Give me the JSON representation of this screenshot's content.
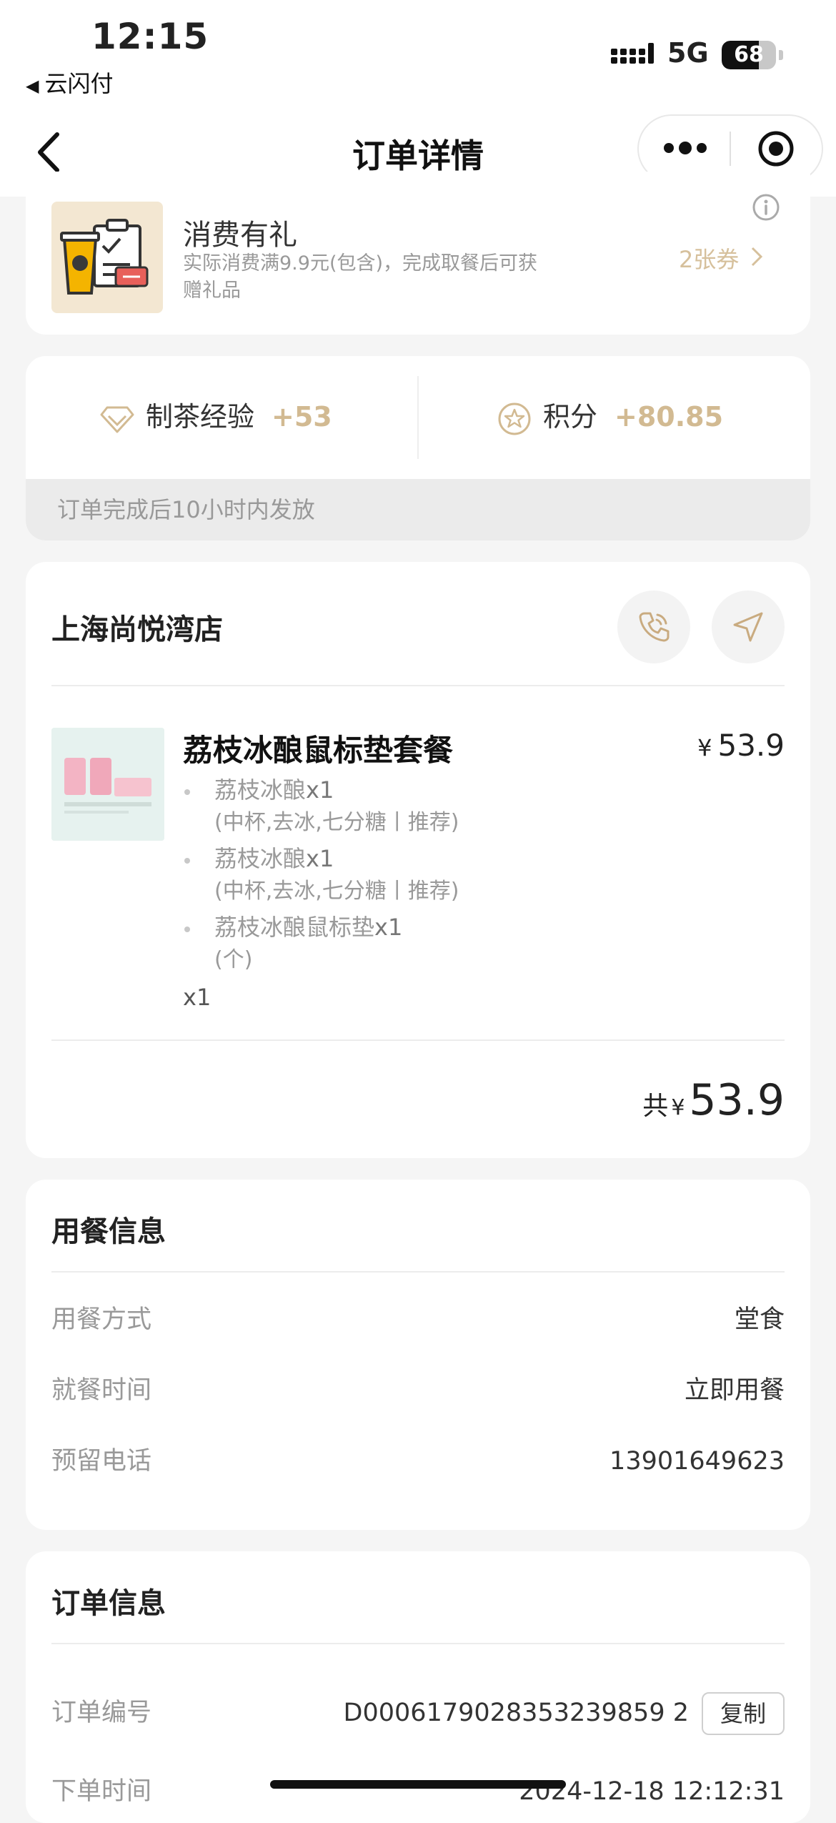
{
  "status_bar": {
    "time": "12:15",
    "back_app": "云闪付",
    "network": "5G",
    "battery": "68",
    "battery_level_pct": 68
  },
  "nav": {
    "title": "订单详情"
  },
  "gift": {
    "title": "消费有礼",
    "desc": "实际消费满9.9元(包含)，完成取餐后可获赠礼品",
    "coupon": "2张券"
  },
  "rewards": {
    "exp_label": "制茶经验",
    "exp_value": "+53",
    "points_label": "积分",
    "points_value": "+80.85",
    "note": "订单完成后10小时内发放"
  },
  "store": {
    "name": "上海尚悦湾店"
  },
  "product": {
    "name": "荔枝冰酿鼠标垫套餐",
    "currency": "¥",
    "price": "53.9",
    "items": [
      {
        "name": "荔枝冰酿",
        "qty": "x1",
        "options": "(中杯,去冰,七分糖丨推荐)"
      },
      {
        "name": "荔枝冰酿",
        "qty": "x1",
        "options": "(中杯,去冰,七分糖丨推荐)"
      },
      {
        "name": "荔枝冰酿鼠标垫",
        "qty": "x1",
        "options": "(个)"
      }
    ],
    "quantity": "x1"
  },
  "total": {
    "label": "共",
    "currency": "¥",
    "amount": "53.9"
  },
  "dining": {
    "title": "用餐信息",
    "rows": [
      {
        "label": "用餐方式",
        "value": "堂食"
      },
      {
        "label": "就餐时间",
        "value": "立即用餐"
      },
      {
        "label": "预留电话",
        "value": "13901649623"
      }
    ]
  },
  "order": {
    "title": "订单信息",
    "id_label": "订单编号",
    "id_value": "D0006179028353239859 2",
    "copy_label": "复制",
    "time_label": "下单时间",
    "time_value": "2024-12-18 12:12:31"
  },
  "colors": {
    "accent_gold": "#d2ba92",
    "page_bg": "#f5f5f5"
  }
}
